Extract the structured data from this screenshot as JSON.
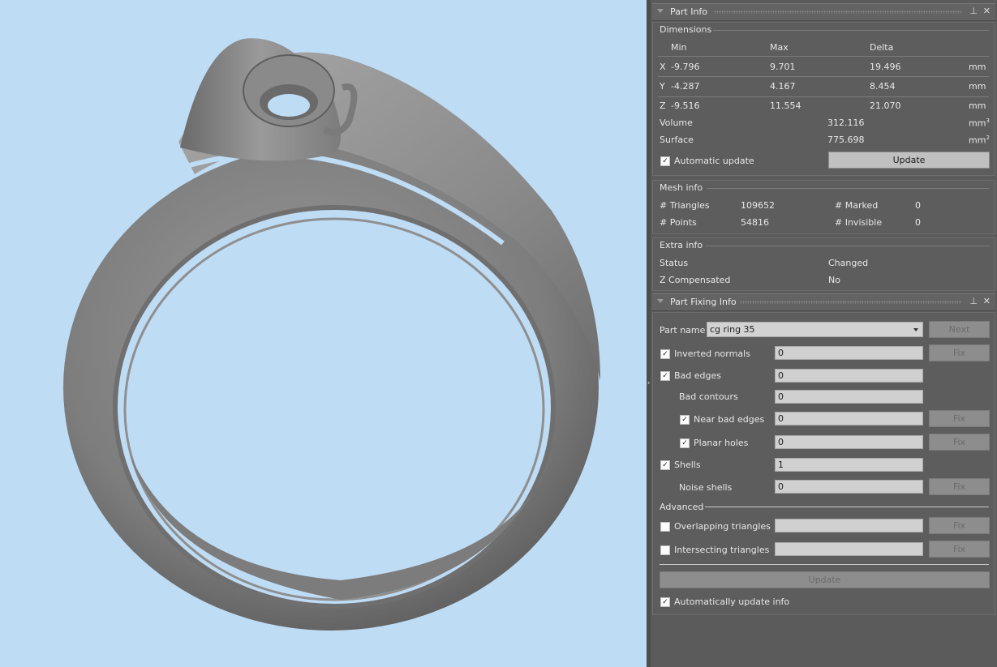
{
  "viewport": {
    "background": "#bfdcf5",
    "model": "ring"
  },
  "part_info": {
    "title": "Part Info",
    "dimensions": {
      "title": "Dimensions",
      "headers": {
        "min": "Min",
        "max": "Max",
        "delta": "Delta"
      },
      "rows": [
        {
          "axis": "X",
          "min": "-9.796",
          "max": "9.701",
          "delta": "19.496",
          "unit": "mm"
        },
        {
          "axis": "Y",
          "min": "-4.287",
          "max": "4.167",
          "delta": "8.454",
          "unit": "mm"
        },
        {
          "axis": "Z",
          "min": "-9.516",
          "max": "11.554",
          "delta": "21.070",
          "unit": "mm"
        }
      ],
      "volume": {
        "label": "Volume",
        "value": "312.116",
        "unit": "mm",
        "sup": "3"
      },
      "surface": {
        "label": "Surface",
        "value": "775.698",
        "unit": "mm",
        "sup": "2"
      },
      "auto_update_label": "Automatic update",
      "update_button": "Update"
    },
    "mesh_info": {
      "title": "Mesh info",
      "triangles_label": "# Triangles",
      "triangles": "109652",
      "points_label": "# Points",
      "points": "54816",
      "marked_label": "# Marked",
      "marked": "0",
      "invisible_label": "# Invisible",
      "invisible": "0"
    },
    "extra_info": {
      "title": "Extra info",
      "status_label": "Status",
      "status": "Changed",
      "zcomp_label": "Z Compensated",
      "zcomp": "No"
    }
  },
  "part_fixing": {
    "title": "Part Fixing Info",
    "part_name_label": "Part name",
    "part_name": "cg ring 35",
    "next_button": "Next",
    "fix_label": "Fix",
    "inverted_normals": {
      "label": "Inverted normals",
      "value": "0"
    },
    "bad_edges": {
      "label": "Bad edges",
      "value": "0"
    },
    "bad_contours": {
      "label": "Bad contours",
      "value": "0"
    },
    "near_bad_edges": {
      "label": "Near bad edges",
      "value": "0"
    },
    "planar_holes": {
      "label": "Planar holes",
      "value": "0"
    },
    "shells": {
      "label": "Shells",
      "value": "1"
    },
    "noise_shells": {
      "label": "Noise shells",
      "value": "0"
    },
    "advanced_label": "Advanced",
    "overlapping": {
      "label": "Overlapping triangles",
      "value": ""
    },
    "intersecting": {
      "label": "Intersecting triangles",
      "value": ""
    },
    "update_button": "Update",
    "auto_update_info_label": "Automatically update info"
  }
}
